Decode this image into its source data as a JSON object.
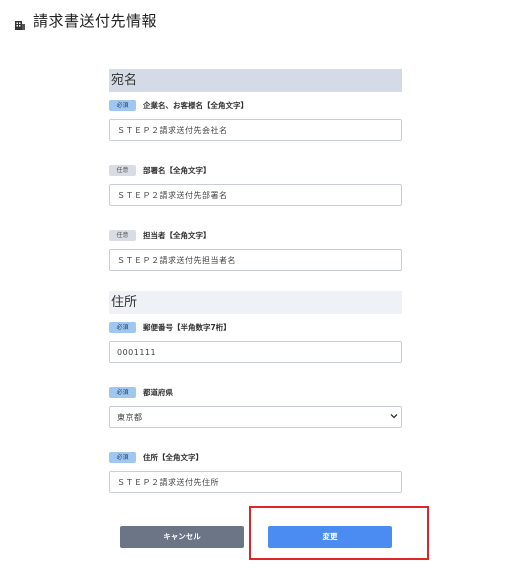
{
  "header": {
    "title": "請求書送付先情報",
    "icon": "building-icon"
  },
  "sections": [
    {
      "title": "宛名"
    },
    {
      "title": "住所"
    }
  ],
  "fields": [
    {
      "badge": "必須",
      "label": "企業名、お客様名【全角文字】",
      "value": "ＳＴＥＰ２請求送付先会社名"
    },
    {
      "badge": "任意",
      "label": "部署名【全角文字】",
      "value": "ＳＴＥＰ２請求送付先部署名"
    },
    {
      "badge": "任意",
      "label": "担当者【全角文字】",
      "value": "ＳＴＥＰ２請求送付先担当者名"
    },
    {
      "badge": "必須",
      "label": "郵便番号【半角数字7桁】",
      "value": "0001111"
    },
    {
      "badge": "必須",
      "label": "都道府県",
      "value": "東京都"
    },
    {
      "badge": "必須",
      "label": "住所【全角文字】",
      "value": "ＳＴＥＰ２請求送付先住所"
    }
  ],
  "buttons": {
    "cancel": "キャンセル",
    "change": "変更"
  },
  "colors": {
    "accent": "#4a8cf2",
    "highlight": "#e02525",
    "section": "#d4dbe6"
  }
}
